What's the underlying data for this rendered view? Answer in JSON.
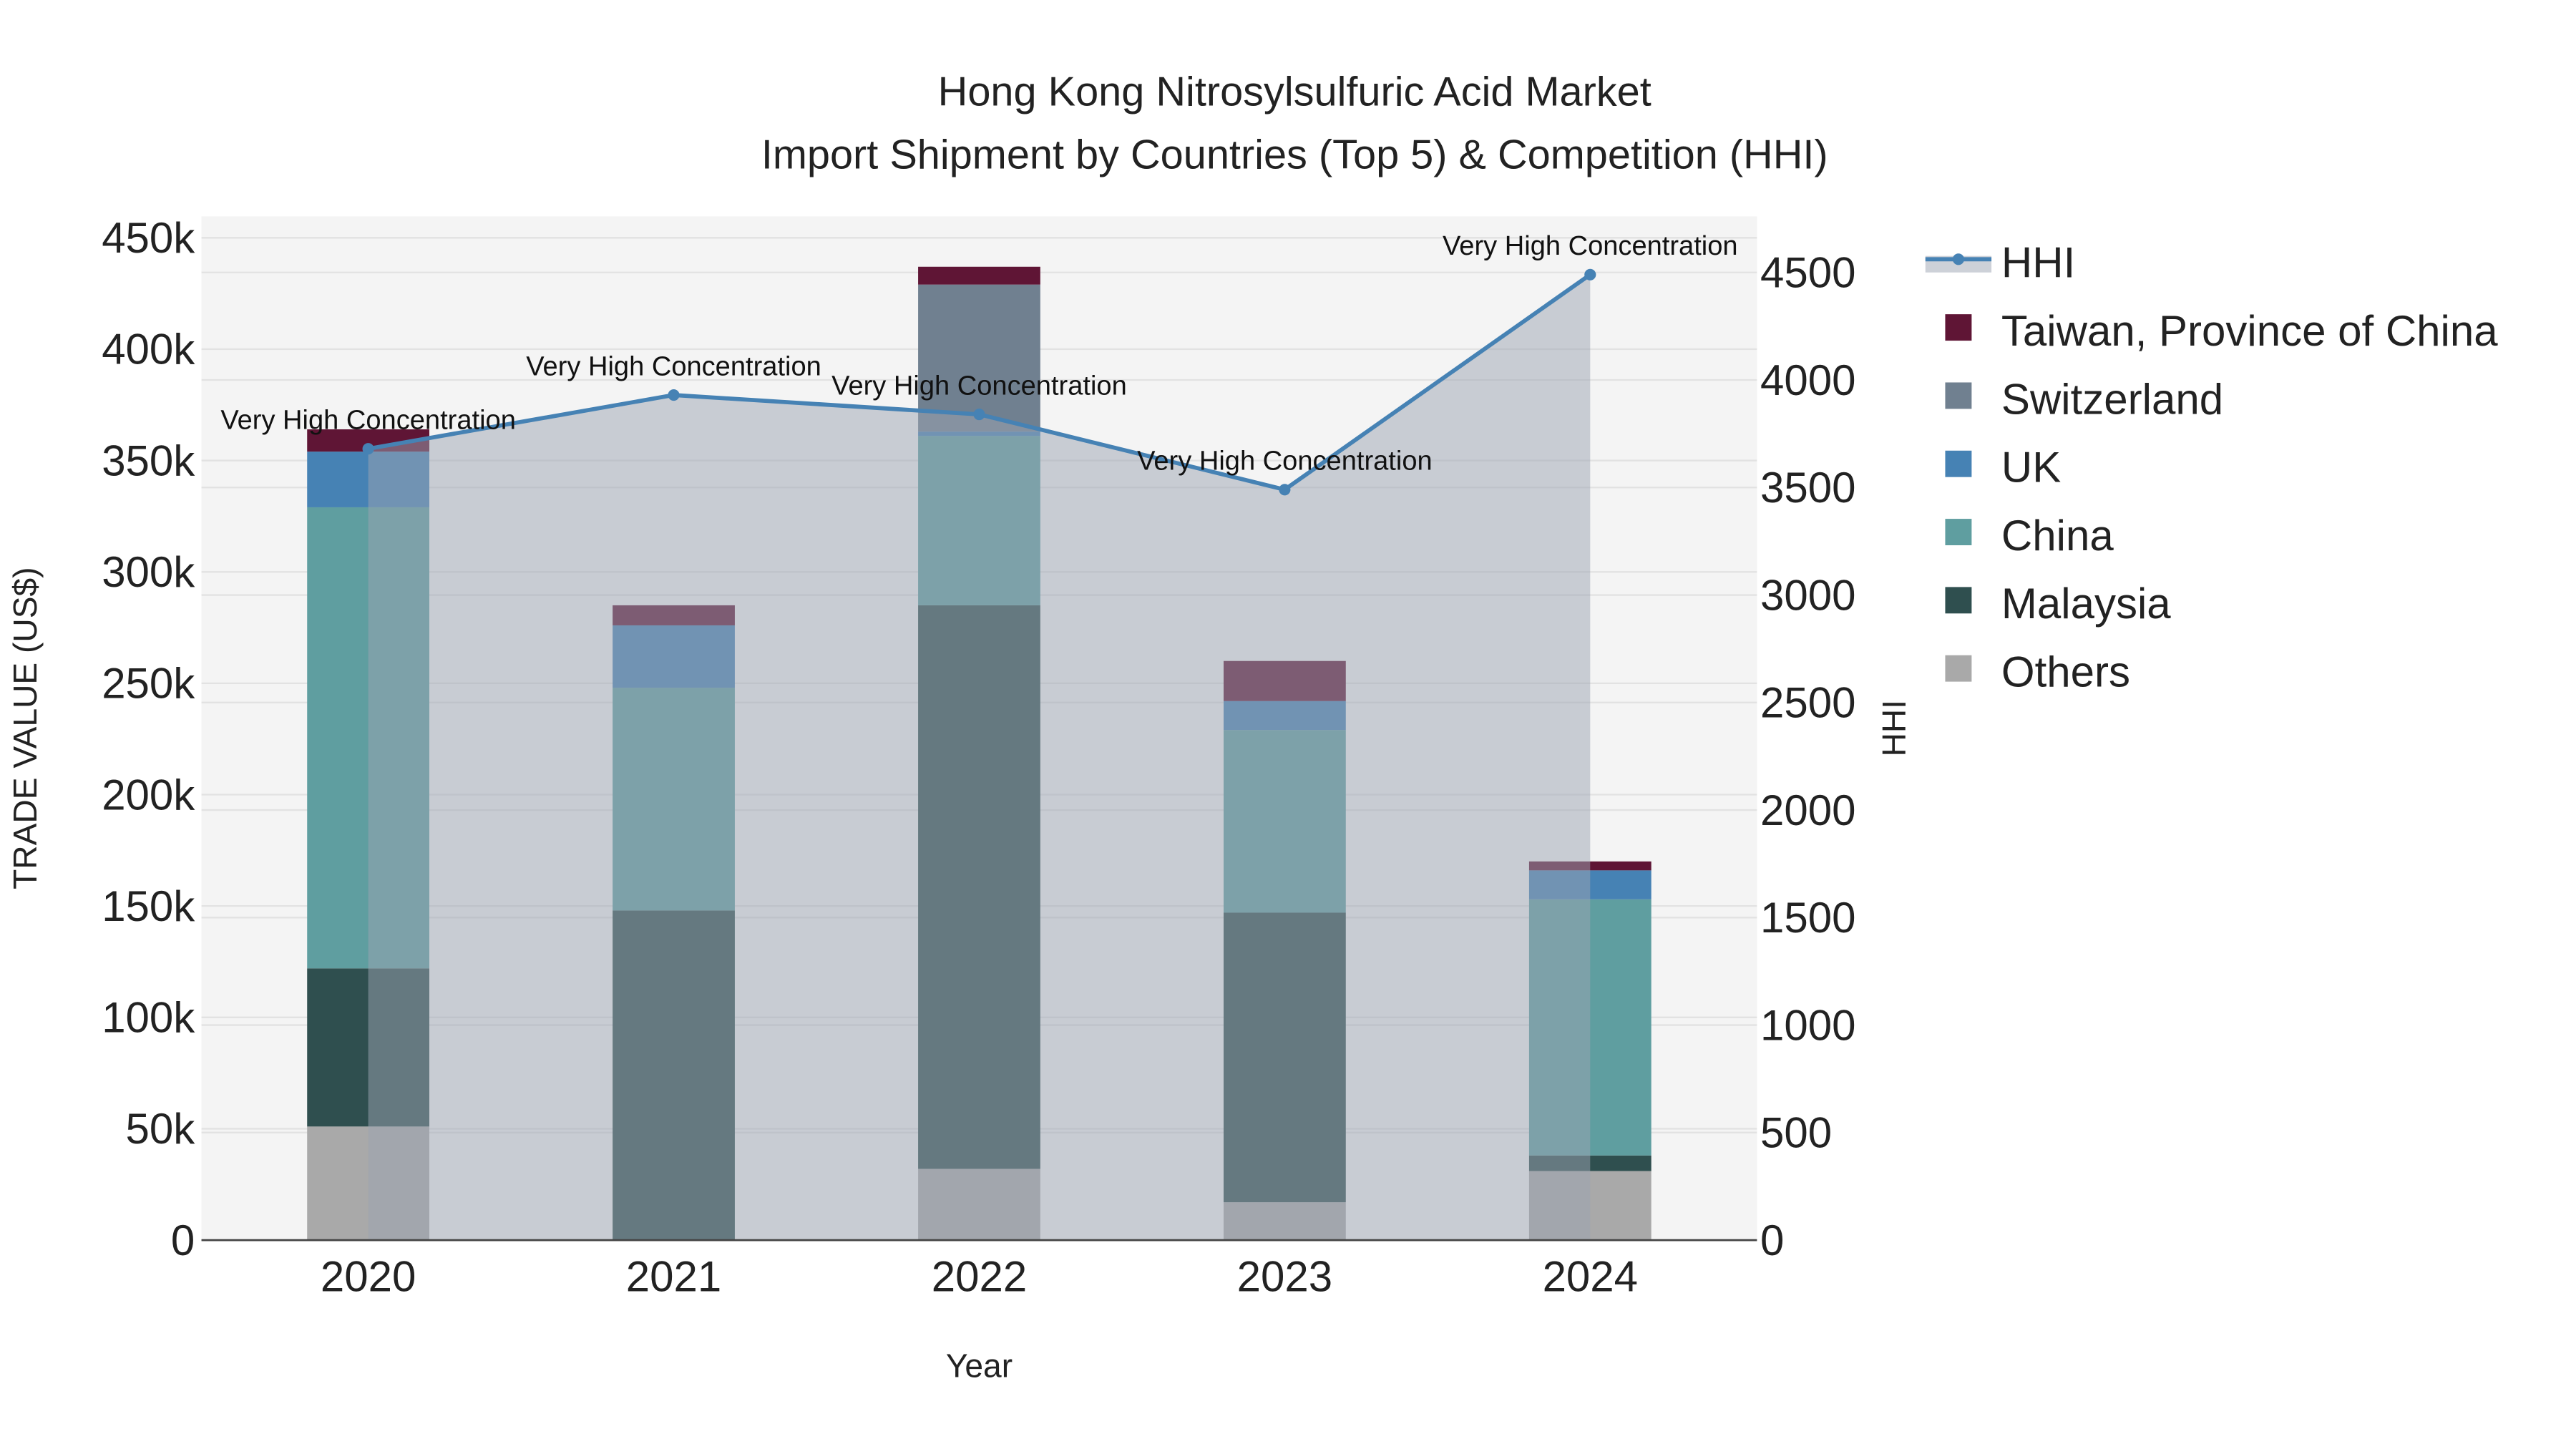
{
  "chart_data": {
    "type": "bar",
    "title_line1": "Hong Kong Nitrosylsulfuric Acid Market",
    "title_line2": "Import Shipment by Countries (Top 5) & Competition (HHI)",
    "xlabel": "Year",
    "ylabel": "TRADE VALUE (US$)",
    "y2label": "HHI",
    "categories": [
      "2020",
      "2021",
      "2022",
      "2023",
      "2024"
    ],
    "ylim": [
      0,
      450000
    ],
    "y2lim": [
      0,
      4500
    ],
    "yticks": [
      0,
      50000,
      100000,
      150000,
      200000,
      250000,
      300000,
      350000,
      400000,
      450000
    ],
    "ytick_labels": [
      "0",
      "50k",
      "100k",
      "150k",
      "200k",
      "250k",
      "300k",
      "350k",
      "400k",
      "450k"
    ],
    "y2ticks": [
      0,
      500,
      1000,
      1500,
      2000,
      2500,
      3000,
      3500,
      4000,
      4500
    ],
    "y2tick_labels": [
      "0",
      "500",
      "1000",
      "1500",
      "2000",
      "2500",
      "3000",
      "3500",
      "4000",
      "4500"
    ],
    "stack_order": [
      "Others",
      "Malaysia",
      "China",
      "UK",
      "Switzerland",
      "Taiwan, Province of China"
    ],
    "series": [
      {
        "name": "Others",
        "color": "#a9a9a9",
        "values": [
          51000,
          0,
          32000,
          17000,
          31000
        ]
      },
      {
        "name": "Malaysia",
        "color": "#2f4f4f",
        "values": [
          71000,
          148000,
          253000,
          130000,
          7000
        ]
      },
      {
        "name": "China",
        "color": "#5f9ea0",
        "values": [
          207000,
          100000,
          76000,
          82000,
          115000
        ]
      },
      {
        "name": "UK",
        "color": "#4682b4",
        "values": [
          25000,
          28000,
          2000,
          13000,
          13000
        ]
      },
      {
        "name": "Switzerland",
        "color": "#708090",
        "values": [
          0,
          0,
          66000,
          0,
          0
        ]
      },
      {
        "name": "Taiwan, Province of China",
        "color": "#5f1535",
        "values": [
          10000,
          9000,
          8000,
          18000,
          4000
        ]
      }
    ],
    "hhi": {
      "name": "HHI",
      "color": "#4682b4",
      "values": [
        3680,
        3930,
        3840,
        3490,
        4490
      ]
    },
    "annotations": [
      "Very High Concentration",
      "Very High Concentration",
      "Very High Concentration",
      "Very High Concentration",
      "Very High Concentration"
    ],
    "legend": [
      "HHI",
      "Taiwan, Province of China",
      "Switzerland",
      "UK",
      "China",
      "Malaysia",
      "Others"
    ],
    "legend_position": "right",
    "grid": true
  }
}
